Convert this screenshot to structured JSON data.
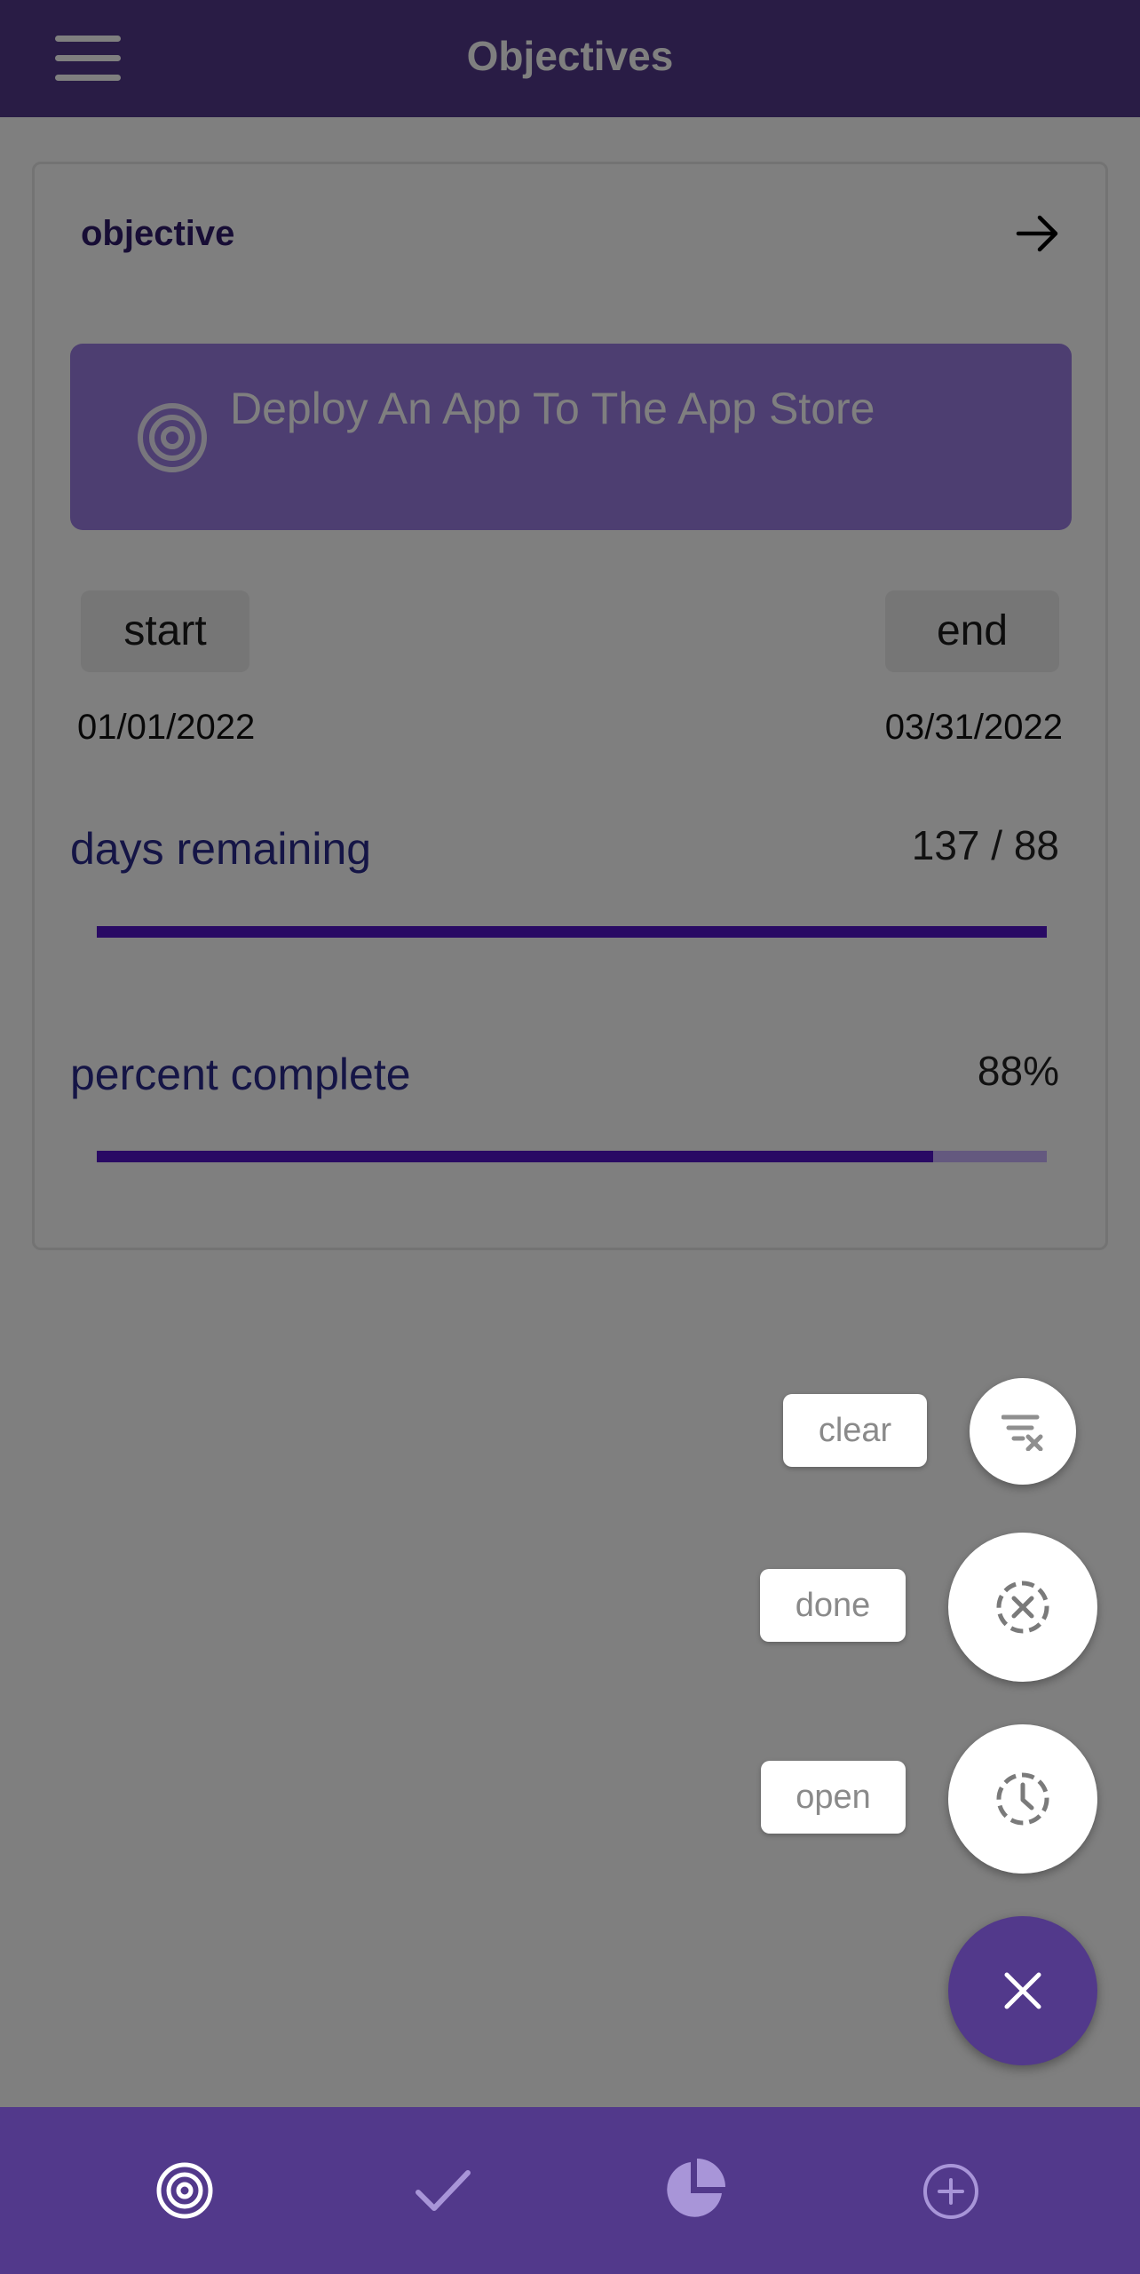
{
  "app_bar": {
    "title": "Objectives",
    "menu_icon": "hamburger-menu-icon"
  },
  "card": {
    "title": "objective",
    "open_icon": "arrow-right-icon",
    "objective": {
      "icon": "target-icon",
      "text": "Deploy An App To The App Store"
    },
    "start": {
      "label": "start",
      "date": "01/01/2022"
    },
    "end": {
      "label": "end",
      "date": "03/31/2022"
    },
    "days_remaining": {
      "label": "days remaining",
      "value": "137 / 88",
      "progress": 1.0
    },
    "percent_complete": {
      "label": "percent complete",
      "value": "88%",
      "progress": 0.88
    }
  },
  "fab_menu": {
    "actions": [
      {
        "label": "clear",
        "icon": "filter-clear-icon"
      },
      {
        "label": "done",
        "icon": "dashed-circle-x-icon"
      },
      {
        "label": "open",
        "icon": "dashed-clock-icon"
      }
    ],
    "close_icon": "close-icon"
  },
  "bottom_nav": {
    "items": [
      {
        "icon": "target-icon",
        "active": true
      },
      {
        "icon": "check-icon",
        "active": false
      },
      {
        "icon": "pie-chart-icon",
        "active": false
      },
      {
        "icon": "add-circle-icon",
        "active": false
      }
    ]
  },
  "colors": {
    "primary": "#52398b",
    "banner": "#9b7de3",
    "progress_track": "#c9b3ff",
    "progress_fill": "#5214c9",
    "label_text": "#2a2a8c"
  }
}
